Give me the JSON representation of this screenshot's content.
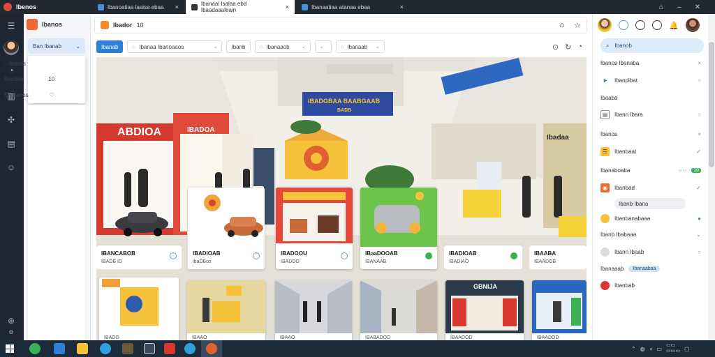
{
  "brand": {
    "name": "Ibenos"
  },
  "tabs": [
    {
      "label": "Ibanoatiaa laaisa ebaa",
      "active": false
    },
    {
      "label": "Ibanaal Isalaa ebd Ibaadaaaleain",
      "active": true
    },
    {
      "label": "Ibanaatiaa atanaa ebaa",
      "active": false
    }
  ],
  "app": {
    "title": "Ibanos"
  },
  "sidebar": {
    "select_label": "Ban Ibanab",
    "dropdown": [
      {
        "label": "Ibanos",
        "end": ""
      },
      {
        "label": "Ibanbes",
        "end": "10"
      },
      {
        "label": "Ibanos",
        "end": ""
      }
    ]
  },
  "main": {
    "header_title": "Ibador",
    "header_count": "10",
    "filters": {
      "primary": "Ibanab",
      "f1": "Ibanaa Ibanoaaos",
      "f2": "Ibanb",
      "f3": "Ibanaaob",
      "f4": "Ibanaab"
    },
    "hero_sign_top": "IBADGBAA BAABGAAB",
    "hero_sign_sub": "BADB",
    "hero_store_sign": "ABDIOA",
    "hero_store_sign2": "IBADOA",
    "hero_store_right": "Ibadaa",
    "products": [
      {
        "title": "IBANCABOB",
        "sub": "IBADB ID"
      },
      {
        "title": "IBADIOAB",
        "sub": "ibaDBos"
      },
      {
        "title": "IBADOOU",
        "sub": "IBADDO"
      },
      {
        "title": "IBaaDOOAB",
        "sub": "IBANAAB"
      },
      {
        "title": "IBADIOAB",
        "sub": "IBADIAO"
      },
      {
        "title": "IBAABA",
        "sub": "IBAADOB"
      }
    ],
    "row2_labels": [
      "IBADO",
      "IBAAO",
      "IBAAO",
      "IBABADOD",
      "IBAADOD",
      "IBAADOD"
    ],
    "row2_sign": "GBNIJA"
  },
  "rightpanel": {
    "search": "Ibanob",
    "rows": [
      {
        "label": "Ibanos Ibanaba",
        "end": "×",
        "icon": "close-icon"
      },
      {
        "label": "Ibanpibat",
        "end": "○"
      },
      {
        "label": "Ibaaba",
        "end": ""
      },
      {
        "label": "Ibann Ibara",
        "end": "○"
      },
      {
        "label": "Ibanos",
        "end": "×"
      },
      {
        "label": "Ibanbaat",
        "end": "✓"
      },
      {
        "label": "Ibanaboaba",
        "end": "○ ○"
      },
      {
        "label": "Ibanbad",
        "end": "✓"
      },
      {
        "label": "Ibanb Ibana",
        "end": ""
      },
      {
        "label": "Ibanbanabaaa",
        "end": "●"
      },
      {
        "label": "Ibanb Ibabaaa",
        "end": "⌄"
      },
      {
        "label": "Ibann Ibaab",
        "end": "○"
      },
      {
        "label": "Ibanaaab",
        "end": ""
      },
      {
        "label": "Ibanbab",
        "end": ""
      }
    ],
    "tag": "Ibanaabaa",
    "rows_toggle": "10"
  },
  "colors": {
    "accent": "#2f7fd8",
    "brand": "#e04a3a",
    "success": "#3cb054"
  }
}
